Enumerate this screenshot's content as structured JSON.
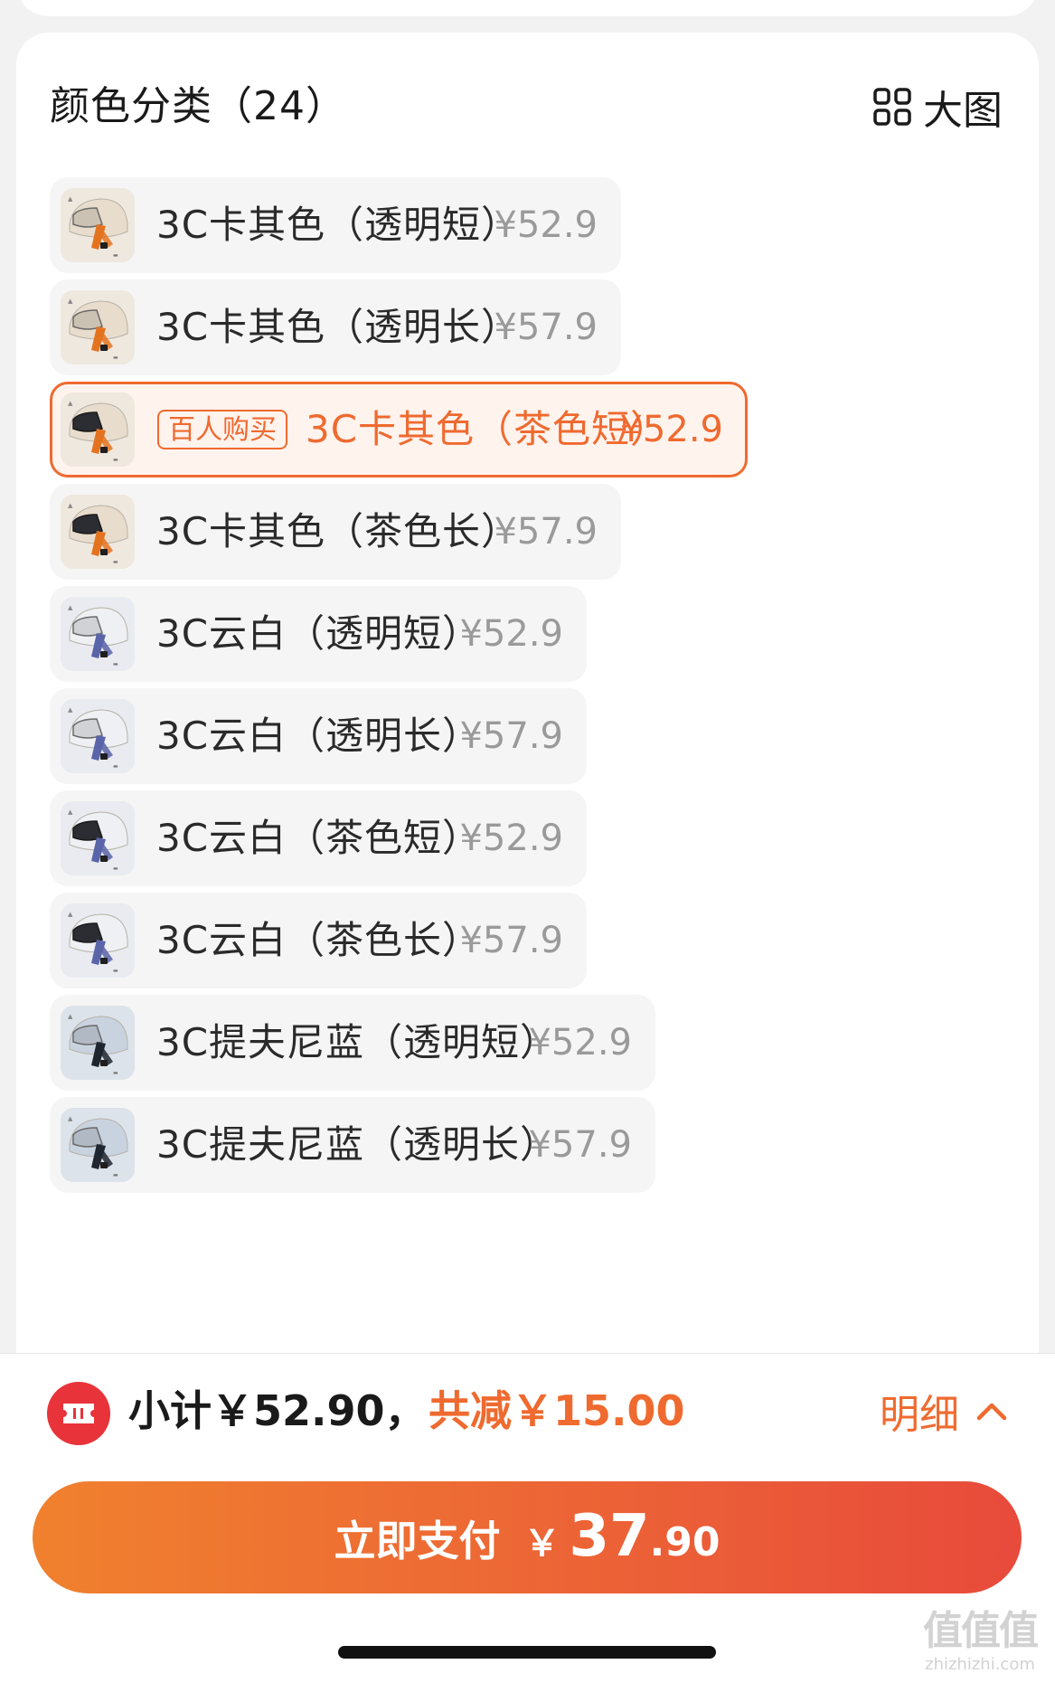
{
  "section": {
    "title": "颜色分类（24）",
    "big_view_label": "大图",
    "big_view_icon": "grid-icon"
  },
  "items": [
    {
      "name": "3C卡其色（透明短）",
      "price": "¥52.9",
      "shell": "khaki",
      "visor": "clear",
      "selected": false
    },
    {
      "name": "3C卡其色（透明长）",
      "price": "¥57.9",
      "shell": "khaki",
      "visor": "clear",
      "selected": false
    },
    {
      "name": "3C卡其色（茶色短）",
      "price": "¥52.9",
      "shell": "khaki",
      "visor": "tinted",
      "selected": true,
      "tag": "百人购买"
    },
    {
      "name": "3C卡其色（茶色长）",
      "price": "¥57.9",
      "shell": "khaki",
      "visor": "tinted",
      "selected": false
    },
    {
      "name": "3C云白（透明短）",
      "price": "¥52.9",
      "shell": "white",
      "visor": "clear",
      "selected": false
    },
    {
      "name": "3C云白（透明长）",
      "price": "¥57.9",
      "shell": "white",
      "visor": "clear",
      "selected": false
    },
    {
      "name": "3C云白（茶色短）",
      "price": "¥52.9",
      "shell": "white",
      "visor": "tinted",
      "selected": false
    },
    {
      "name": "3C云白（茶色长）",
      "price": "¥57.9",
      "shell": "white",
      "visor": "tinted",
      "selected": false
    },
    {
      "name": "3C提夫尼蓝（透明短）",
      "price": "¥52.9",
      "shell": "blue",
      "visor": "clear",
      "selected": false
    },
    {
      "name": "3C提夫尼蓝（透明长）",
      "price": "¥57.9",
      "shell": "blue",
      "visor": "clear",
      "selected": false
    }
  ],
  "footer": {
    "coupon_icon": "ticket-icon",
    "subtotal": "小计￥52.90，",
    "discount": "共减￥15.00",
    "detail_label": "明细",
    "detail_icon": "chevron-up-icon",
    "pay_label": "立即支付",
    "pay_currency": "￥",
    "pay_amount_int": "37",
    "pay_amount_dec": ".90"
  },
  "watermark": {
    "mark": "值值值",
    "text": "zhizhizhi.com"
  },
  "colors": {
    "accent": "#ef6a2f",
    "accent_bg": "#fff3ee",
    "price_gray": "#9a9a9a",
    "row_bg": "#f5f5f5",
    "shell_khaki": "#e8ddcc",
    "shell_white": "#eef0f4",
    "shell_blue": "#c9d3e0",
    "strap_khaki": "#e4731f",
    "strap_white": "#5a64a8",
    "strap_blue": "#1f2630"
  }
}
